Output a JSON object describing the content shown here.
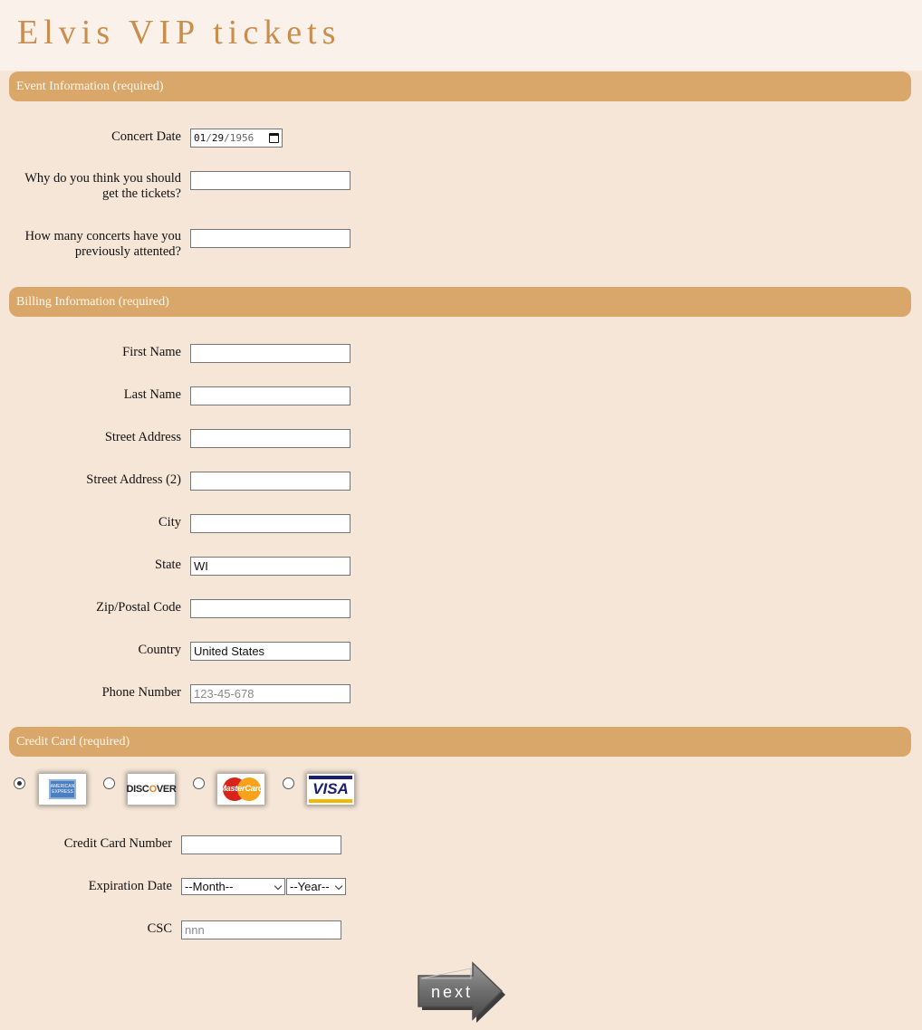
{
  "page": {
    "title": "Elvis VIP tickets"
  },
  "sections": {
    "event": "Event Information (required)",
    "billing": "Billing Information (required)",
    "credit": "Credit Card (required)"
  },
  "event": {
    "concert_date": {
      "label": "Concert Date",
      "month": "01",
      "day": "29",
      "year": "1956"
    },
    "why": {
      "label_line1": "Why do you think you should",
      "label_line2": "get the tickets?",
      "value": ""
    },
    "how_many": {
      "label_line1": "How many concerts have you",
      "label_line2": "previously attented?",
      "value": ""
    }
  },
  "billing": {
    "first_name": {
      "label": "First Name",
      "value": ""
    },
    "last_name": {
      "label": "Last Name",
      "value": ""
    },
    "street1": {
      "label": "Street Address",
      "value": ""
    },
    "street2": {
      "label": "Street Address (2)",
      "value": ""
    },
    "city": {
      "label": "City",
      "value": ""
    },
    "state": {
      "label": "State",
      "value": "WI"
    },
    "zip": {
      "label": "Zip/Postal Code",
      "value": ""
    },
    "country": {
      "label": "Country",
      "value": "United States"
    },
    "phone": {
      "label": "Phone Number",
      "value": "",
      "placeholder": "123-45-678"
    }
  },
  "credit": {
    "cards": [
      {
        "name": "amex",
        "icon": "amex-card-icon",
        "selected": true,
        "text": "AMERICAN EXPRESS"
      },
      {
        "name": "discover",
        "icon": "discover-card-icon",
        "selected": false,
        "text_a": "DISC",
        "text_o": "O",
        "text_b": "VER"
      },
      {
        "name": "mastercard",
        "icon": "mastercard-card-icon",
        "selected": false,
        "text": "MasterCard"
      },
      {
        "name": "visa",
        "icon": "visa-card-icon",
        "selected": false,
        "text": "VISA"
      }
    ],
    "number": {
      "label": "Credit Card Number",
      "value": ""
    },
    "expiration": {
      "label": "Expiration Date",
      "month": "--Month--",
      "year": "--Year--"
    },
    "csc": {
      "label": "CSC",
      "value": "",
      "placeholder": "nnn"
    }
  },
  "next_button": {
    "label": "next",
    "icon": "arrow-right-icon"
  },
  "colors": {
    "background": "#f5e6d8",
    "header": "#faf1ea",
    "section_bar": "#daa76a",
    "title": "#c98e4d"
  }
}
